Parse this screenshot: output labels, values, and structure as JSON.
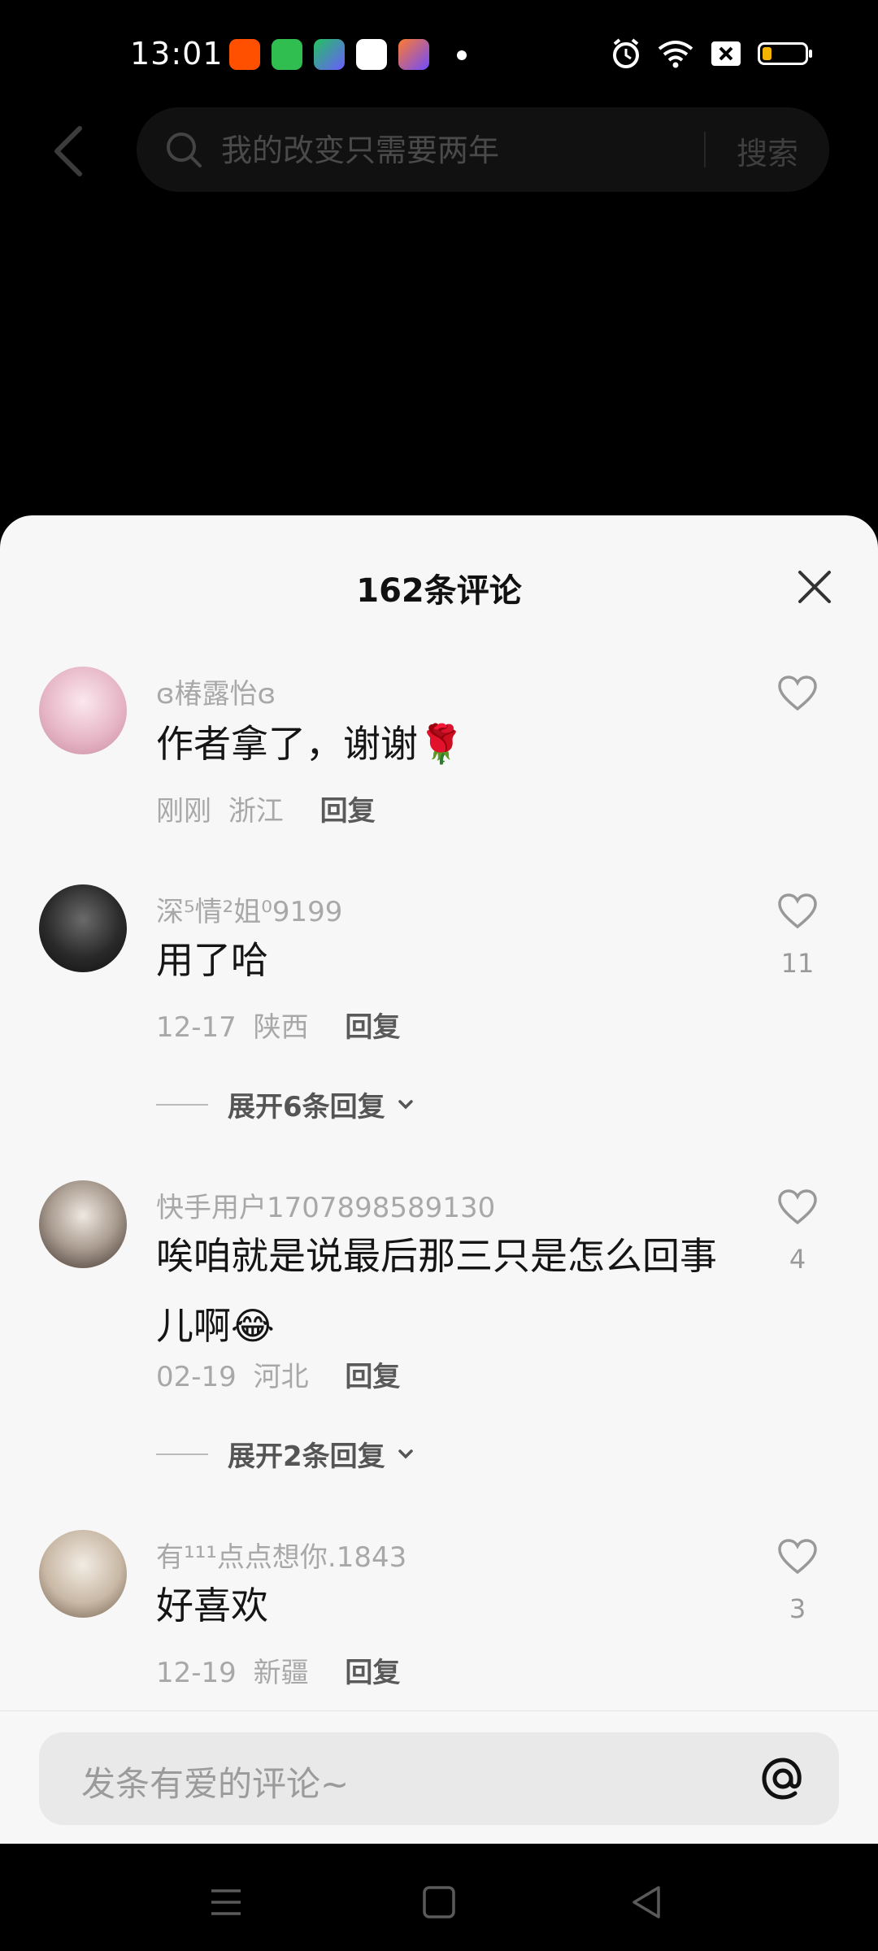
{
  "status_bar": {
    "time": "13:01",
    "battery_level": 0.22
  },
  "search": {
    "placeholder": "我的改变只需要两年",
    "button_label": "搜索"
  },
  "sheet": {
    "title": "162条评论"
  },
  "comments": [
    {
      "username": "ɞ椿露怡ɞ",
      "content": "作者拿了，谢谢🌹",
      "date": "刚刚",
      "location": "浙江",
      "reply_label": "回复",
      "likes": ""
    },
    {
      "username": "深⁵情²姐⁰9199",
      "content": "用了哈",
      "date": "12-17",
      "location": "陕西",
      "reply_label": "回复",
      "likes": "11",
      "expand_label": "展开6条回复"
    },
    {
      "username": "快手用户1707898589130",
      "content": "唉咱就是说最后那三只是怎么回事儿啊😂",
      "date": "02-19",
      "location": "河北",
      "reply_label": "回复",
      "likes": "4",
      "expand_label": "展开2条回复"
    },
    {
      "username": "有¹¹¹点点想你.1843",
      "content": "好喜欢",
      "date": "12-19",
      "location": "新疆",
      "reply_label": "回复",
      "likes": "3"
    }
  ],
  "input": {
    "placeholder": "发条有爱的评论~"
  },
  "colors": {
    "accent": "#111111",
    "sheet_bg": "#f7f7f7",
    "battery": "#f5b400"
  }
}
